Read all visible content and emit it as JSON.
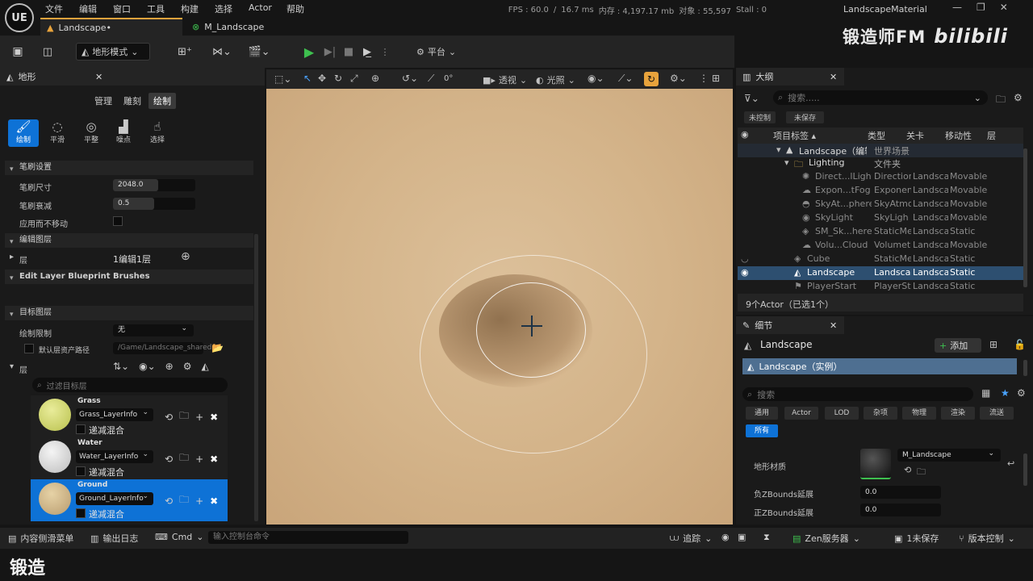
{
  "menu": [
    "文件",
    "编辑",
    "窗口",
    "工具",
    "构建",
    "选择",
    "Actor",
    "帮助"
  ],
  "stats": {
    "fps": "FPS : 60.0",
    "ms": "16.7 ms",
    "mem": "内存 : 4,197.17 mb",
    "objects": "对象 : 55,597",
    "stall": "Stall : 0"
  },
  "window_title": "LandscapeMaterial",
  "watermark": "锻造师FM",
  "watermark_site": "bilibili",
  "logo": "UE",
  "tabs": [
    {
      "label": "Landscape•"
    },
    {
      "label": "M_Landscape"
    }
  ],
  "toolbar": {
    "mode": "地形模式",
    "platform": "平台"
  },
  "viewport_toolbar": {
    "snap_value": "0°",
    "perspective": "透视",
    "lighting": "光照"
  },
  "landscape_panel": {
    "title": "地形",
    "mode_tabs": [
      "管理",
      "雕刻",
      "绘制"
    ],
    "tools": [
      {
        "label": "绘制"
      },
      {
        "label": "平滑"
      },
      {
        "label": "平整"
      },
      {
        "label": "噪点"
      },
      {
        "label": "选择"
      }
    ],
    "brush_section": "笔刷设置",
    "brush_size_label": "笔刷尺寸",
    "brush_size_value": "2048.0",
    "brush_size_fill": 0.55,
    "brush_falloff_label": "笔刷衰减",
    "brush_falloff_value": "0.5",
    "brush_falloff_fill": 0.5,
    "use_without_move_label": "应用而不移动",
    "edit_layers_section": "编辑图层",
    "layers_label": "层",
    "layers_value": "1编辑1层",
    "blueprint_section": "Edit Layer Blueprint Brushes",
    "target_section": "目标图层",
    "paint_limit_label": "绘制限制",
    "paint_limit_value": "无",
    "default_path_label": "默认层资产路径",
    "default_path_value": "/Game/Landscape_shared",
    "target_layers_label": "层",
    "filter_placeholder": "过滤目标层",
    "layers": [
      {
        "name": "Grass",
        "info": "Grass_LayerInfo",
        "blend": "递减混合"
      },
      {
        "name": "Water",
        "info": "Water_LayerInfo",
        "blend": "递减混合"
      },
      {
        "name": "Ground",
        "info": "Ground_LayerInfo",
        "blend": "递减混合"
      }
    ]
  },
  "outliner": {
    "title": "大纲",
    "search_placeholder": "搜索.....",
    "chips": [
      "未控制",
      "未保存"
    ],
    "columns": [
      "项目标签 ▴",
      "类型",
      "关卡",
      "移动性",
      "层"
    ],
    "rows": [
      {
        "label": "Landscape（编辑",
        "type": "世界场景",
        "level": "",
        "mobility": ""
      },
      {
        "label": "Lighting",
        "type": "文件夹",
        "level": "",
        "mobility": ""
      },
      {
        "label": "Direct...lLight",
        "type": "Direction",
        "level": "Landsca",
        "mobility": "Movable"
      },
      {
        "label": "Expon...tFog",
        "type": "Exponen",
        "level": "Landsca",
        "mobility": "Movable"
      },
      {
        "label": "SkyAt...phere",
        "type": "SkyAtmo",
        "level": "Landsca",
        "mobility": "Movable"
      },
      {
        "label": "SkyLight",
        "type": "SkyLigh",
        "level": "Landsca",
        "mobility": "Movable"
      },
      {
        "label": "SM_Sk...here",
        "type": "StaticMe",
        "level": "Landsca",
        "mobility": "Static"
      },
      {
        "label": "Volu...Cloud",
        "type": "Volumet",
        "level": "Landsca",
        "mobility": "Movable"
      },
      {
        "label": "Cube",
        "type": "StaticMe",
        "level": "Landsca",
        "mobility": "Static"
      },
      {
        "label": "Landscape",
        "type": "Landsca",
        "level": "Landsca",
        "mobility": "Static"
      },
      {
        "label": "PlayerStart",
        "type": "PlayerSt",
        "level": "Landsca",
        "mobility": "Static"
      }
    ],
    "footer": "9个Actor（已选1个）"
  },
  "details": {
    "title": "细节",
    "actor_name": "Landscape",
    "add_label": "添加",
    "instance": "Landscape（实例）",
    "search_placeholder": "搜索",
    "filters": [
      "通用",
      "Actor",
      "LOD",
      "杂项",
      "物理",
      "渲染",
      "流送",
      "所有"
    ],
    "material_label": "地形材质",
    "material_value": "M_Landscape",
    "neg_z_label": "负ZBounds延展",
    "neg_z_value": "0.0",
    "pos_z_label": "正ZBounds延展",
    "pos_z_value": "0.0"
  },
  "statusbar": {
    "content_drawer": "内容侧滑菜单",
    "output_log": "输出日志",
    "cmd": "Cmd",
    "console_placeholder": "输入控制台命令",
    "trace": "追踪",
    "zen": "Zen服务器",
    "unsaved": "1未保存",
    "source_control": "版本控制"
  },
  "subtitle": "锻造"
}
